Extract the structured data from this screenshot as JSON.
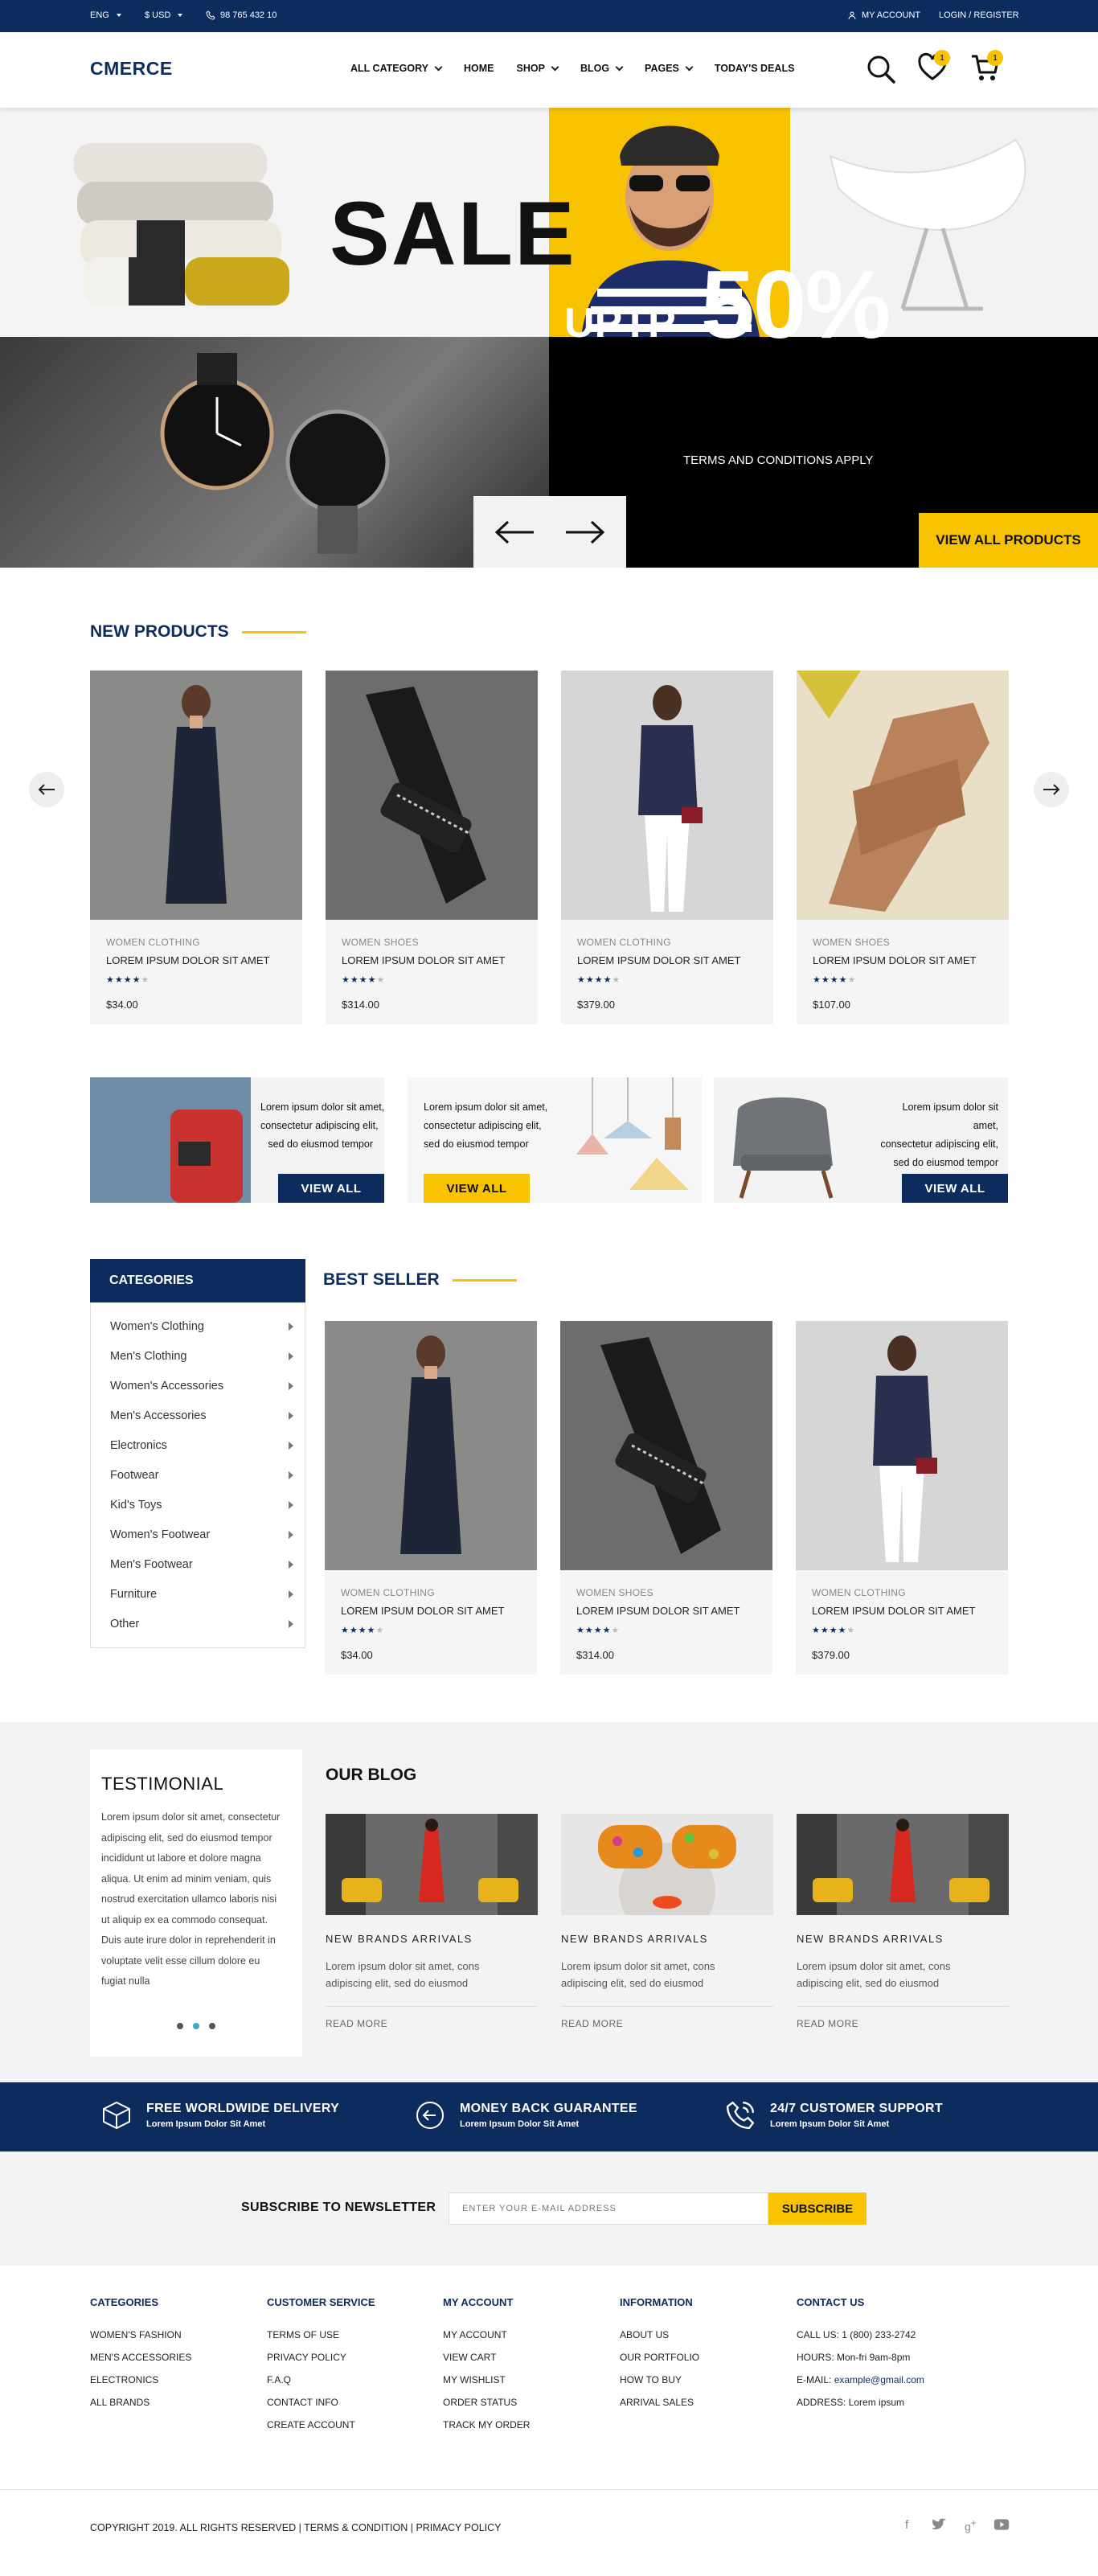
{
  "topbar": {
    "language": "ENG",
    "currency": "$ USD",
    "phone": "98 765 432 10",
    "my_account": "MY ACCOUNT",
    "login": "LOGIN / REGISTER"
  },
  "header": {
    "logo": "CMERCE",
    "nav": [
      {
        "label": "ALL CATEGORY",
        "dropdown": true
      },
      {
        "label": "HOME",
        "dropdown": false
      },
      {
        "label": "SHOP",
        "dropdown": true
      },
      {
        "label": "BLOG",
        "dropdown": true
      },
      {
        "label": "PAGES",
        "dropdown": true
      },
      {
        "label": "TODAY'S DEALS",
        "dropdown": false
      }
    ],
    "wishlist_count": "1",
    "cart_count": "1"
  },
  "hero": {
    "sale": "SALE",
    "uptp": "UPTP",
    "percent": "50%",
    "terms": "TERMS AND CONDITIONS APPLY",
    "view_all": "VIEW ALL PRODUCTS"
  },
  "new_products": {
    "title": "NEW PRODUCTS",
    "items": [
      {
        "category": "WOMEN CLOTHING",
        "name": "LOREM IPSUM DOLOR SIT AMET",
        "price": "$34.00",
        "rating": 4
      },
      {
        "category": "WOMEN SHOES",
        "name": "LOREM IPSUM DOLOR SIT AMET",
        "price": "$314.00",
        "rating": 4
      },
      {
        "category": "WOMEN CLOTHING",
        "name": "LOREM IPSUM DOLOR SIT AMET",
        "price": "$379.00",
        "rating": 4
      },
      {
        "category": "WOMEN SHOES",
        "name": "LOREM IPSUM DOLOR SIT AMET",
        "price": "$107.00",
        "rating": 4
      }
    ]
  },
  "promos": [
    {
      "text": [
        "Lorem ipsum dolor sit amet,",
        "consectetur adipiscing elit,",
        "sed do eiusmod tempor"
      ],
      "button": "VIEW ALL"
    },
    {
      "text": [
        "Lorem ipsum dolor sit amet,",
        "consectetur adipiscing elit,",
        "sed do eiusmod tempor"
      ],
      "button": "VIEW ALL"
    },
    {
      "text": [
        "Lorem ipsum dolor sit amet,",
        "consectetur adipiscing elit,",
        "sed do eiusmod tempor"
      ],
      "button": "VIEW ALL"
    }
  ],
  "categories": {
    "title": "CATEGORIES",
    "items": [
      "Women's Clothing",
      "Men's Clothing",
      "Women's Accessories",
      "Men's Accessories",
      "Electronics",
      "Footwear",
      "Kid's Toys",
      "Women's Footwear",
      "Men's Footwear",
      "Furniture",
      "Other"
    ]
  },
  "best_seller": {
    "title": "BEST SELLER",
    "items": [
      {
        "category": "WOMEN CLOTHING",
        "name": "LOREM IPSUM DOLOR SIT AMET",
        "price": "$34.00",
        "rating": 4
      },
      {
        "category": "WOMEN SHOES",
        "name": "LOREM IPSUM DOLOR SIT AMET",
        "price": "$314.00",
        "rating": 4
      },
      {
        "category": "WOMEN CLOTHING",
        "name": "LOREM IPSUM DOLOR SIT AMET",
        "price": "$379.00",
        "rating": 4
      }
    ]
  },
  "testimonial": {
    "title": "TESTIMONIAL",
    "lines": [
      "Lorem ipsum dolor sit amet, consectetur",
      "adipiscing elit, sed do eiusmod tempor",
      "incididunt ut labore et dolore magna",
      "aliqua. Ut enim ad minim veniam, quis",
      "nostrud exercitation ullamco laboris nisi",
      "ut aliquip ex ea commodo consequat.",
      "Duis aute irure dolor in reprehenderit in",
      "voluptate velit esse cillum dolore eu",
      "fugiat nulla"
    ]
  },
  "blog": {
    "title": "OUR BLOG",
    "posts": [
      {
        "title": "NEW BRANDS ARRIVALS",
        "text": [
          "Lorem ipsum dolor sit amet, cons",
          "adipiscing elit, sed do eiusmod"
        ],
        "read_more": "READ MORE"
      },
      {
        "title": "NEW BRANDS ARRIVALS",
        "text": [
          "Lorem ipsum dolor sit amet, cons",
          "adipiscing elit, sed do eiusmod"
        ],
        "read_more": "READ MORE"
      },
      {
        "title": "NEW BRANDS ARRIVALS",
        "text": [
          "Lorem ipsum dolor sit amet, cons",
          "adipiscing elit, sed do eiusmod"
        ],
        "read_more": "READ MORE"
      }
    ]
  },
  "features": [
    {
      "title": "FREE WORLDWIDE DELIVERY",
      "sub": "Lorem Ipsum Dolor Sit Amet"
    },
    {
      "title": "MONEY BACK GUARANTEE",
      "sub": "Lorem Ipsum Dolor Sit Amet"
    },
    {
      "title": "24/7 CUSTOMER SUPPORT",
      "sub": "Lorem Ipsum Dolor Sit Amet"
    }
  ],
  "newsletter": {
    "label": "SUBSCRIBE TO NEWSLETTER",
    "placeholder": "ENTER YOUR E-MAIL ADDRESS",
    "button": "SUBSCRIBE"
  },
  "footer": {
    "columns": [
      {
        "title": "CATEGORIES",
        "links": [
          "WOMEN'S FASHION",
          "MEN'S ACCESSORIES",
          "ELECTRONICS",
          "ALL BRANDS"
        ]
      },
      {
        "title": "CUSTOMER SERVICE",
        "links": [
          "TERMS OF USE",
          "PRIVACY POLICY",
          "F.A.Q",
          "CONTACT INFO",
          "CREATE ACCOUNT"
        ]
      },
      {
        "title": "MY ACCOUNT",
        "links": [
          "MY ACCOUNT",
          "VIEW CART",
          "MY WISHLIST",
          "ORDER STATUS",
          "TRACK MY ORDER"
        ]
      },
      {
        "title": "INFORMATION",
        "links": [
          "ABOUT US",
          "OUR PORTFOLIO",
          "HOW TO BUY",
          "ARRIVAL SALES"
        ]
      }
    ],
    "contact": {
      "title": "CONTACT US",
      "call": "CALL US: 1 (800) 233-2742",
      "hours": "HOURS: Mon-fri 9am-8pm",
      "email_label": "E-MAIL: ",
      "email": "example@gmail.com",
      "address": "ADDRESS: Lorem ipsum"
    },
    "copyright": "COPYRIGHT 2019. ALL RIGHTS RESERVED | TERMS & CONDITION | PRIMACY POLICY"
  },
  "colors": {
    "navy": "#0d2c5e",
    "yellow": "#f7c300"
  }
}
